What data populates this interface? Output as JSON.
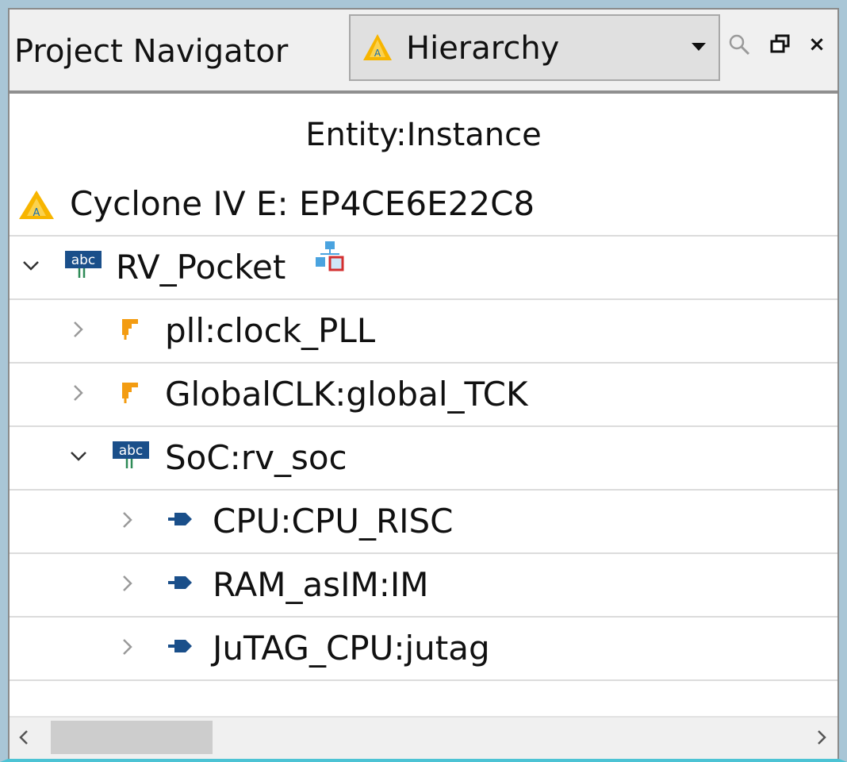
{
  "panel": {
    "title": "Project Navigator",
    "view_selector": {
      "selected": "Hierarchy",
      "icon": "triangle-device-icon"
    },
    "buttons": {
      "search": "search-icon",
      "restore": "restore-window-icon",
      "close": "×"
    }
  },
  "tree": {
    "column_header": "Entity:Instance",
    "device": {
      "label": "Cyclone IV E: EP4CE6E22C8",
      "icon": "triangle-device-icon"
    },
    "items": [
      {
        "label": "RV_Pocket",
        "level": 0,
        "expanded": true,
        "icon": "abc-entity-icon",
        "badge": "hierarchy-icon"
      },
      {
        "label": "pll:clock_PLL",
        "level": 1,
        "expanded": false,
        "icon": "orange-ip-icon"
      },
      {
        "label": "GlobalCLK:global_TCK",
        "level": 1,
        "expanded": false,
        "icon": "orange-ip-icon"
      },
      {
        "label": "SoC:rv_soc",
        "level": 1,
        "expanded": true,
        "icon": "abc-entity-icon"
      },
      {
        "label": "CPU:CPU_RISC",
        "level": 2,
        "expanded": false,
        "icon": "blue-module-icon"
      },
      {
        "label": "RAM_asIM:IM",
        "level": 2,
        "expanded": false,
        "icon": "blue-module-icon"
      },
      {
        "label": "JuTAG_CPU:jutag",
        "level": 2,
        "expanded": false,
        "icon": "blue-module-icon"
      }
    ]
  },
  "colors": {
    "frame": "#a9c6d6",
    "accent_bottom": "#4cc3d4",
    "entity_blue": "#1a4f8a",
    "ip_orange": "#f39c12",
    "device_yellow": "#f7b500"
  }
}
